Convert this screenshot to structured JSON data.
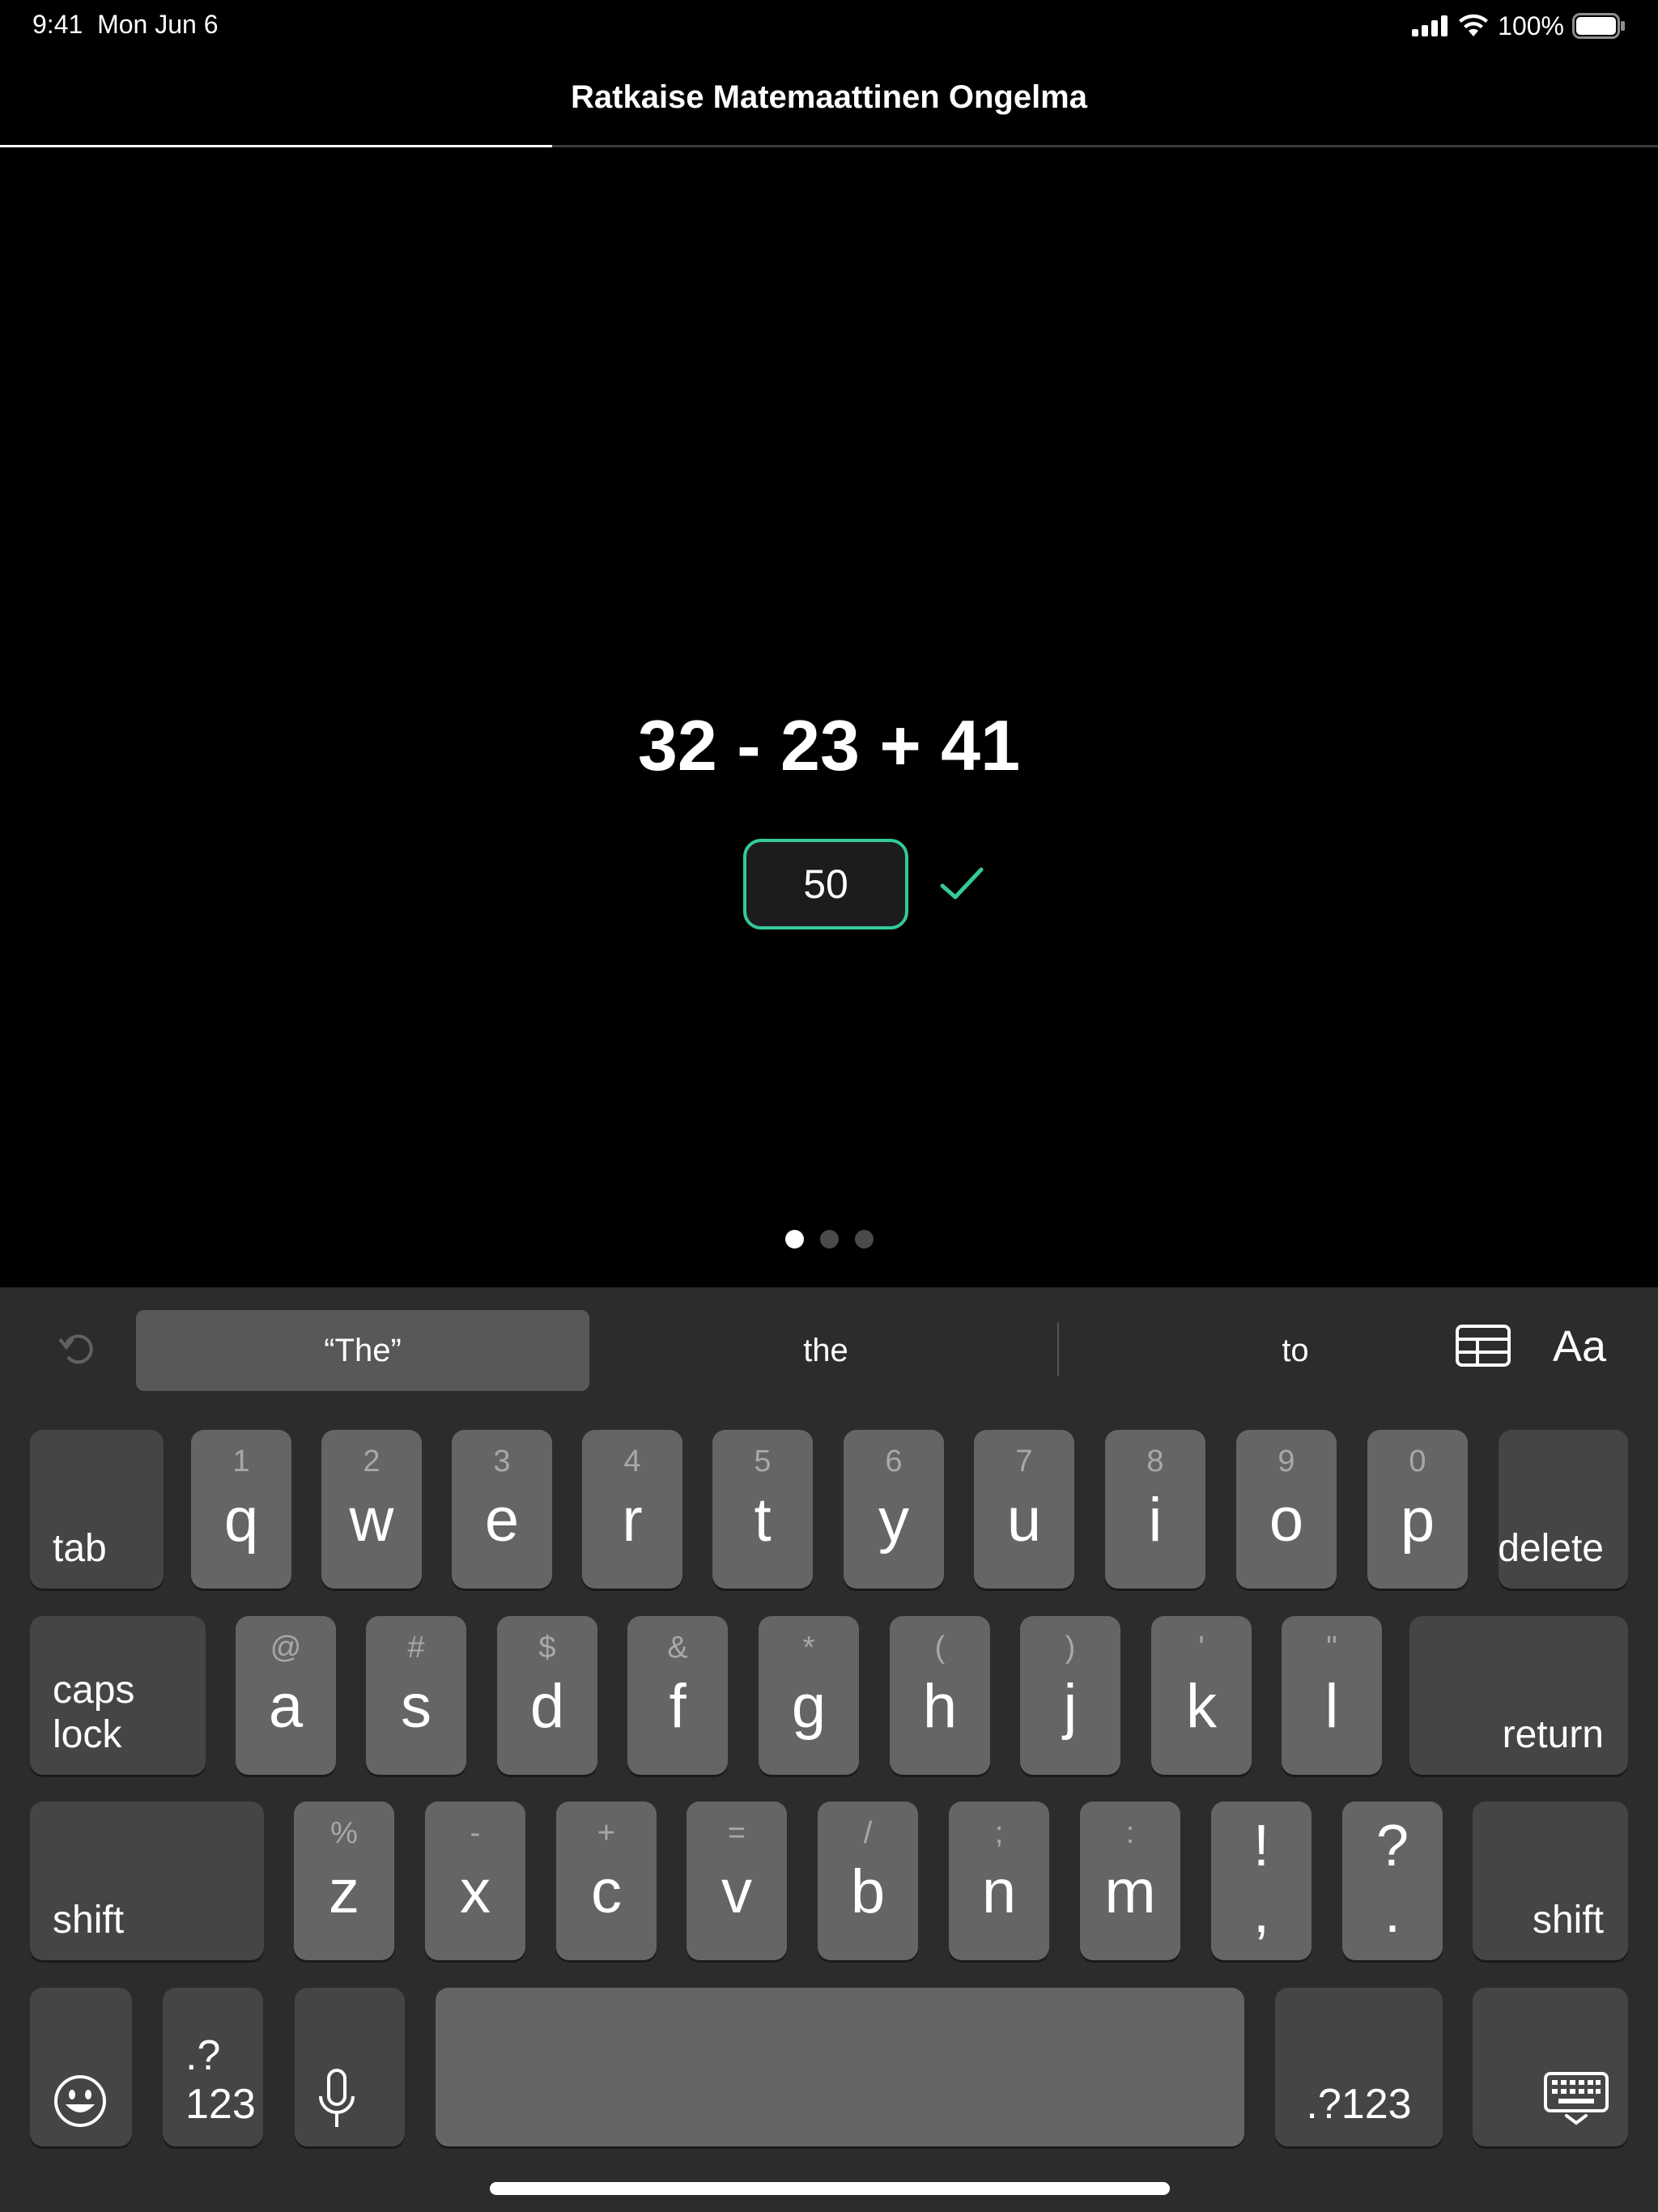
{
  "status_bar": {
    "time": "9:41",
    "date": "Mon Jun 6",
    "battery_percent": "100%",
    "icons": [
      "cellular-signal-icon",
      "wifi-icon",
      "battery-icon"
    ]
  },
  "nav": {
    "title": "Ratkaise Matemaattinen Ongelma",
    "progress": 0.333
  },
  "problem": {
    "expression": "32 - 23 + 41",
    "answer": "50",
    "status_icon": "check-icon",
    "status_color": "#35c99a"
  },
  "pager": {
    "pages": 3,
    "current": 1
  },
  "keyboard": {
    "suggestions": [
      "“The”",
      "the",
      "to"
    ],
    "format_label": "Aa",
    "row1": {
      "tab": "tab",
      "keys": [
        {
          "sec": "1",
          "pri": "q"
        },
        {
          "sec": "2",
          "pri": "w"
        },
        {
          "sec": "3",
          "pri": "e"
        },
        {
          "sec": "4",
          "pri": "r"
        },
        {
          "sec": "5",
          "pri": "t"
        },
        {
          "sec": "6",
          "pri": "y"
        },
        {
          "sec": "7",
          "pri": "u"
        },
        {
          "sec": "8",
          "pri": "i"
        },
        {
          "sec": "9",
          "pri": "o"
        },
        {
          "sec": "0",
          "pri": "p"
        }
      ],
      "delete": "delete"
    },
    "row2": {
      "caps": "caps lock",
      "keys": [
        {
          "sec": "@",
          "pri": "a"
        },
        {
          "sec": "#",
          "pri": "s"
        },
        {
          "sec": "$",
          "pri": "d"
        },
        {
          "sec": "&",
          "pri": "f"
        },
        {
          "sec": "*",
          "pri": "g"
        },
        {
          "sec": "(",
          "pri": "h"
        },
        {
          "sec": ")",
          "pri": "j"
        },
        {
          "sec": "'",
          "pri": "k"
        },
        {
          "sec": "\"",
          "pri": "l"
        }
      ],
      "return": "return"
    },
    "row3": {
      "shift": "shift",
      "keys": [
        {
          "sec": "%",
          "pri": "z"
        },
        {
          "sec": "-",
          "pri": "x"
        },
        {
          "sec": "+",
          "pri": "c"
        },
        {
          "sec": "=",
          "pri": "v"
        },
        {
          "sec": "/",
          "pri": "b"
        },
        {
          "sec": ";",
          "pri": "n"
        },
        {
          "sec": ":",
          "pri": "m"
        }
      ],
      "punct": [
        {
          "top": "!",
          "bottom": ","
        },
        {
          "top": "?",
          "bottom": "."
        }
      ],
      "shift_right": "shift"
    },
    "row4": {
      "numbers_left": ".?123",
      "numbers_right": ".?123"
    }
  }
}
